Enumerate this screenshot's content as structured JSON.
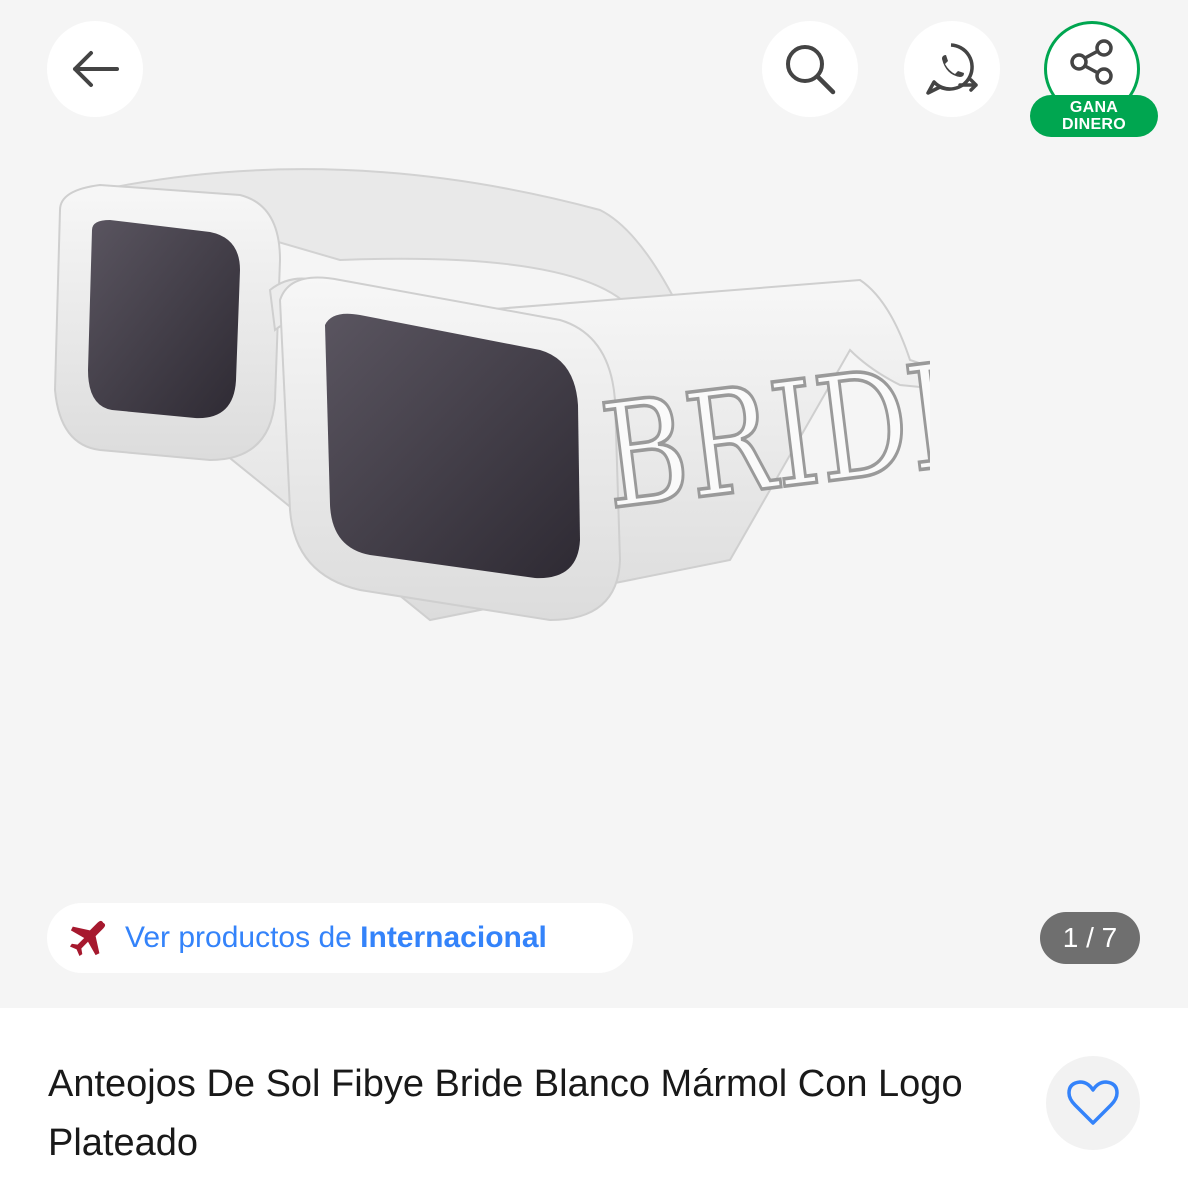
{
  "header": {
    "back_icon": "arrow-left-icon",
    "search_icon": "search-icon",
    "whatsapp_icon": "whatsapp-share-icon",
    "share_icon": "share-icon",
    "earn_line1": "GANA",
    "earn_line2": "DINERO"
  },
  "gallery": {
    "image_text": "BRIDE",
    "counter": "1 / 7"
  },
  "store": {
    "icon": "airplane-icon",
    "prefix": "Ver productos de ",
    "name": "Internacional"
  },
  "product": {
    "title": "Anteojos De Sol Fibye Bride Blanco Mármol Con Logo Plateado",
    "favorite_icon": "heart-outline-icon"
  },
  "colors": {
    "accent_blue": "#3483fa",
    "accent_green": "#00a650",
    "plane_red": "#a6192e"
  }
}
